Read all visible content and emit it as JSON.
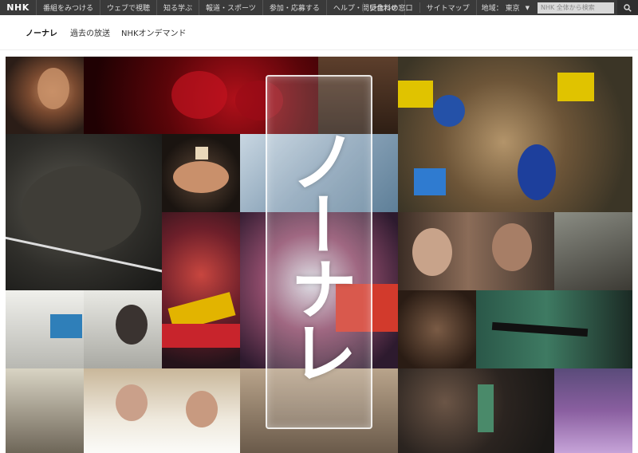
{
  "brand": {
    "logo": "NHK"
  },
  "global_nav": {
    "items": [
      "番組をみつける",
      "ウェブで視聴",
      "知る学ぶ",
      "報道・スポーツ",
      "参加・応募する",
      "ヘルプ・問い合わせ"
    ],
    "right_items": [
      "受信料の窓口",
      "サイトマップ"
    ],
    "region_label": "地域：",
    "region_value": "東京",
    "search_placeholder": "NHK 全体から検索"
  },
  "sub_nav": {
    "items": [
      "ノーナレ",
      "過去の放送",
      "NHKオンデマンド"
    ]
  },
  "hero": {
    "title": "ノーナレ"
  },
  "colors": {
    "topbar_bg": "#3a3a3a",
    "panel_border": "#ffffff"
  },
  "icons": [
    "search-icon",
    "caret-down-icon"
  ]
}
